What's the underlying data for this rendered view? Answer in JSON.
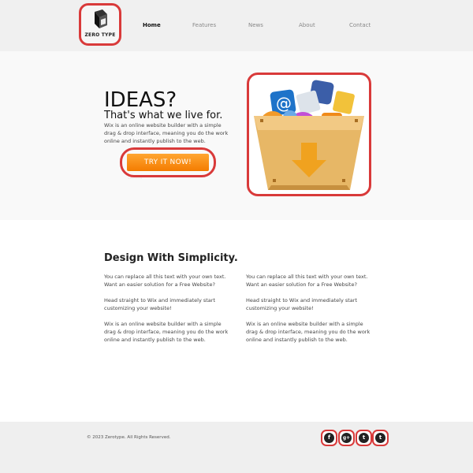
{
  "header": {
    "logo_text": "ZERO TYPE",
    "nav": [
      {
        "label": "Home",
        "active": true
      },
      {
        "label": "Features",
        "active": false
      },
      {
        "label": "News",
        "active": false
      },
      {
        "label": "About",
        "active": false
      },
      {
        "label": "Contact",
        "active": false
      }
    ]
  },
  "hero": {
    "title": "IDEAS?",
    "subtitle": "That's what we live for.",
    "description": "Wix is an online website builder with a simple drag & drop interface, meaning you do the work online and instantly publish to the web.",
    "cta_label": "TRY IT NOW!",
    "image_icon": "box-of-social-icons"
  },
  "content": {
    "title": "Design With Simplicity.",
    "left_column": [
      "You can replace all this text with your own text. Want an easier solution for a Free Website?",
      "Head straight to Wix and immediately start customizing your website!",
      "Wix is an online website builder with a simple drag & drop interface, meaning you do the work online and instantly publish to the web."
    ],
    "right_column": [
      "You can replace all this text with your own text. Want an easier solution for a Free Website?",
      "Head straight to Wix and immediately start customizing your website!",
      "Wix is an online website builder with a simple drag & drop interface, meaning you do the work online and instantly publish to the web."
    ]
  },
  "footer": {
    "copyright": "© 2023 Zerotype. All Rights Reserved.",
    "social": [
      {
        "icon": "facebook-icon",
        "glyph": "f"
      },
      {
        "icon": "google-plus-icon",
        "glyph": "g+"
      },
      {
        "icon": "twitter-icon",
        "glyph": "t"
      },
      {
        "icon": "tumblr-icon",
        "glyph": "t"
      }
    ]
  },
  "colors": {
    "highlight": "#d93a3a",
    "cta": "#f47c00",
    "header_bg": "#f0f0f0",
    "hero_bg": "#f9f9f9",
    "footer_bg": "#efefef"
  }
}
